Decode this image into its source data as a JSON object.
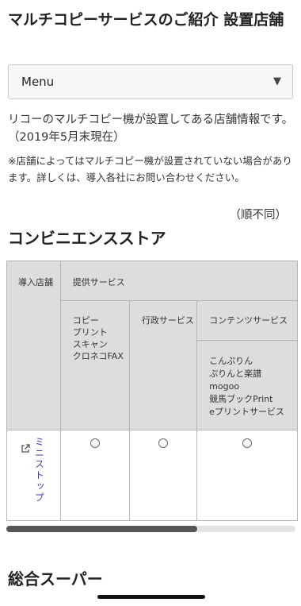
{
  "page": {
    "title": "マルチコピーサービスのご紹介 設置店舗",
    "menu_label": "Menu",
    "menu_arrow": "▼",
    "intro": "リコーのマルチコピー機が設置してある店舗情報です。（2019年5月末現在）",
    "note": "※店舗によってはマルチコピー機が設置されていない場合があります。詳しくは、導入各社にお問い合わせください。",
    "order_note": "（順不同）"
  },
  "sections": {
    "convenience": "コンビニエンスストア",
    "supermarket": "総合スーパー"
  },
  "table": {
    "store_header": "導入店舗",
    "service_header": "提供サービス",
    "copy_services": [
      "コピー",
      "プリント",
      "スキャン",
      "クロネコFAX"
    ],
    "admin_header": "行政サービス",
    "content_header": "コンテンツサービス",
    "content_items": [
      "こんぷりん",
      "ぷりんと楽譜",
      "mogoo",
      "競馬ブックPrint",
      "eプリントサービス"
    ],
    "rows": [
      {
        "store": "ミニストップ",
        "copy": "○",
        "admin": "○",
        "content": "○"
      }
    ]
  },
  "scrollbar": {
    "progress": 0.66
  }
}
